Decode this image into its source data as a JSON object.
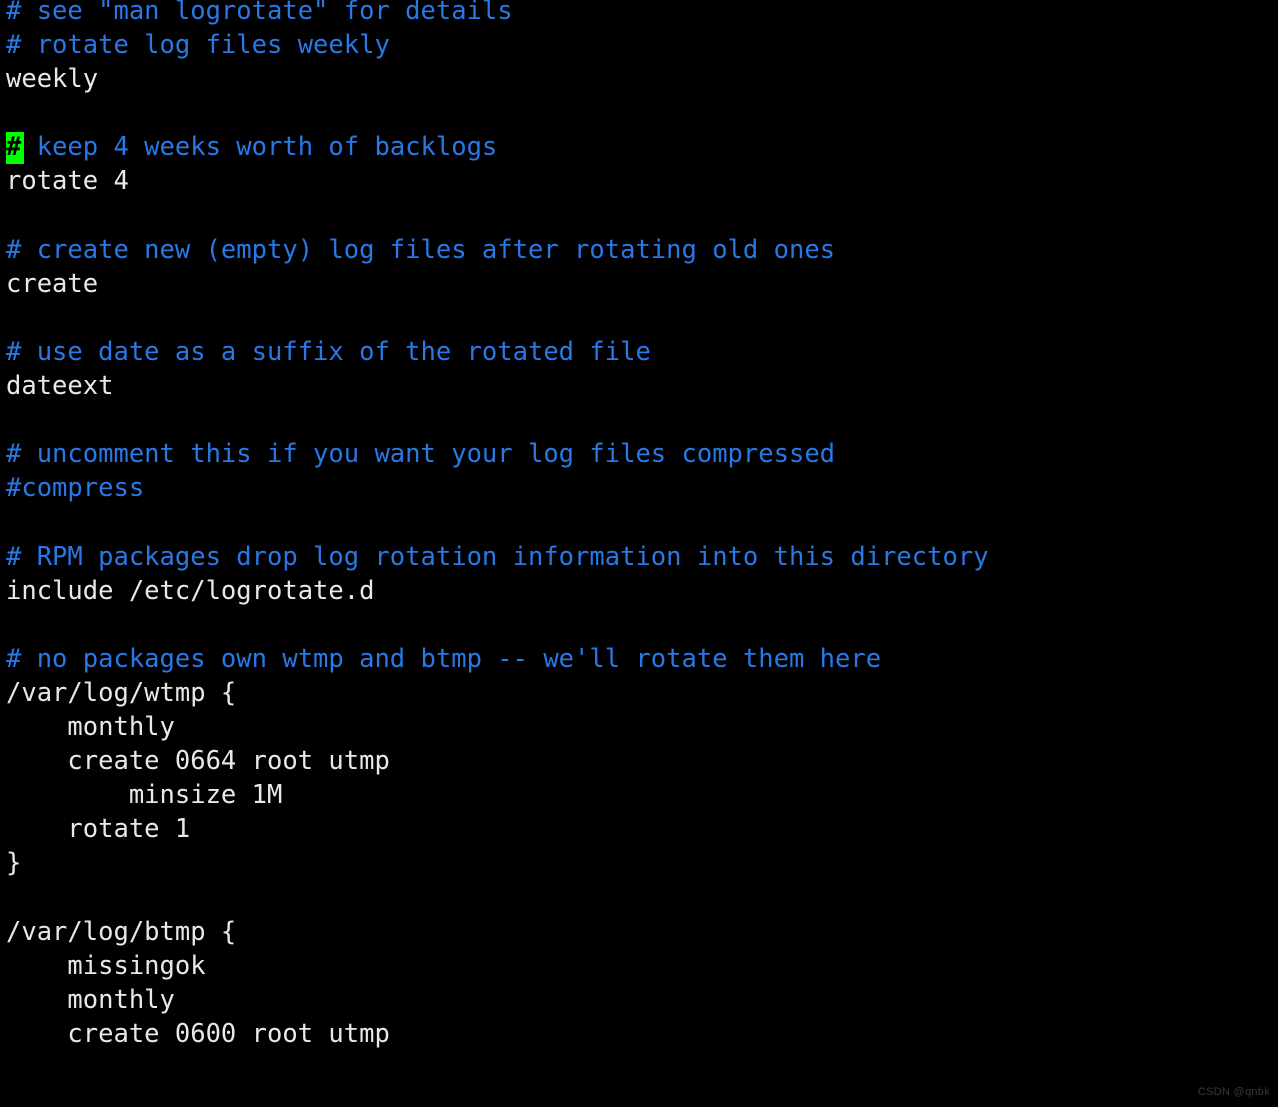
{
  "terminal": {
    "background_color": "#000000",
    "comment_color": "#2878e6",
    "text_color": "#e8e8e8",
    "cursor_color": "#00ff00",
    "cursor_char": "#",
    "cursor_line_index": 4,
    "cursor_column": 0
  },
  "file": {
    "lines": [
      {
        "type": "comment",
        "text": "# see \"man logrotate\" for details"
      },
      {
        "type": "comment",
        "text": "# rotate log files weekly"
      },
      {
        "type": "text",
        "text": "weekly"
      },
      {
        "type": "blank",
        "text": ""
      },
      {
        "type": "comment",
        "text": "# keep 4 weeks worth of backlogs"
      },
      {
        "type": "text",
        "text": "rotate 4"
      },
      {
        "type": "blank",
        "text": ""
      },
      {
        "type": "comment",
        "text": "# create new (empty) log files after rotating old ones"
      },
      {
        "type": "text",
        "text": "create"
      },
      {
        "type": "blank",
        "text": ""
      },
      {
        "type": "comment",
        "text": "# use date as a suffix of the rotated file"
      },
      {
        "type": "text",
        "text": "dateext"
      },
      {
        "type": "blank",
        "text": ""
      },
      {
        "type": "comment",
        "text": "# uncomment this if you want your log files compressed"
      },
      {
        "type": "comment",
        "text": "#compress"
      },
      {
        "type": "blank",
        "text": ""
      },
      {
        "type": "comment",
        "text": "# RPM packages drop log rotation information into this directory"
      },
      {
        "type": "text",
        "text": "include /etc/logrotate.d"
      },
      {
        "type": "blank",
        "text": ""
      },
      {
        "type": "comment",
        "text": "# no packages own wtmp and btmp -- we'll rotate them here"
      },
      {
        "type": "text",
        "text": "/var/log/wtmp {"
      },
      {
        "type": "text",
        "text": "    monthly"
      },
      {
        "type": "text",
        "text": "    create 0664 root utmp"
      },
      {
        "type": "text",
        "text": "        minsize 1M"
      },
      {
        "type": "text",
        "text": "    rotate 1"
      },
      {
        "type": "text",
        "text": "}"
      },
      {
        "type": "blank",
        "text": ""
      },
      {
        "type": "text",
        "text": "/var/log/btmp {"
      },
      {
        "type": "text",
        "text": "    missingok"
      },
      {
        "type": "text",
        "text": "    monthly"
      },
      {
        "type": "text",
        "text": "    create 0600 root utmp"
      }
    ]
  },
  "watermark": {
    "text": "CSDN @qnbk"
  }
}
